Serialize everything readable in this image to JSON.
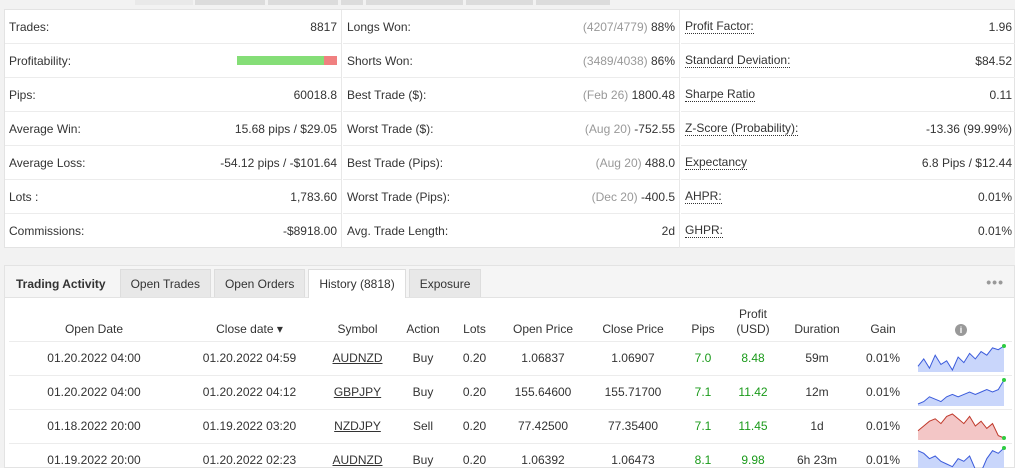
{
  "stats": {
    "col1": [
      {
        "label": "Trades:",
        "value": "8817"
      },
      {
        "label": "Profitability:",
        "bar": {
          "win_fraction": 0.865
        }
      },
      {
        "label": "Pips:",
        "value": "60018.8"
      },
      {
        "label": "Average Win:",
        "value": "15.68 pips / $29.05"
      },
      {
        "label": "Average Loss:",
        "value": "-54.12 pips / -$101.64"
      },
      {
        "label": "Lots :",
        "value": "1,783.60"
      },
      {
        "label": "Commissions:",
        "value": "-$8918.00"
      }
    ],
    "col2": [
      {
        "label": "Longs Won:",
        "muted": "(4207/4779)",
        "value": "88%"
      },
      {
        "label": "Shorts Won:",
        "muted": "(3489/4038)",
        "value": "86%"
      },
      {
        "label": "Best Trade ($):",
        "muted": "(Feb 26)",
        "value": "1800.48"
      },
      {
        "label": "Worst Trade ($):",
        "muted": "(Aug 20)",
        "value": "-752.55"
      },
      {
        "label": "Best Trade (Pips):",
        "muted": "(Aug 20)",
        "value": "488.0"
      },
      {
        "label": "Worst Trade (Pips):",
        "muted": "(Dec 20)",
        "value": "-400.5"
      },
      {
        "label": "Avg. Trade Length:",
        "muted": "",
        "value": "2d"
      }
    ],
    "col3": [
      {
        "label": "Profit Factor:",
        "value": "1.96"
      },
      {
        "label": "Standard Deviation:",
        "value": "$84.52"
      },
      {
        "label": "Sharpe Ratio",
        "value": "0.11"
      },
      {
        "label": "Z-Score (Probability):",
        "value": "-13.36 (99.99%)"
      },
      {
        "label": "Expectancy",
        "value": "6.8 Pips / $12.44"
      },
      {
        "label": "AHPR:",
        "value": "0.01%"
      },
      {
        "label": "GHPR:",
        "value": "0.01%"
      }
    ]
  },
  "activity": {
    "title": "Trading Activity",
    "tabs": [
      "Open Trades",
      "Open Orders",
      "History (8818)",
      "Exposure"
    ],
    "active_tab": 2,
    "more_glyph": "•••",
    "columns": {
      "open_date": "Open Date",
      "close_date": "Close date ▾",
      "symbol": "Symbol",
      "action": "Action",
      "lots": "Lots",
      "open_price": "Open Price",
      "close_price": "Close Price",
      "pips": "Pips",
      "profit_line1": "Profit",
      "profit_line2": "(USD)",
      "duration": "Duration",
      "gain": "Gain",
      "info_icon": "i"
    },
    "rows": [
      {
        "open_date": "01.20.2022 04:00",
        "close_date": "01.20.2022 04:59",
        "symbol": "AUDNZD",
        "action": "Buy",
        "lots": "0.20",
        "open_price": "1.06837",
        "close_price": "1.06907",
        "pips": "7.0",
        "profit": "8.48",
        "duration": "59m",
        "gain": "0.01%",
        "spark": {
          "color": "#3b5bdb",
          "fill": "#c9d6fb",
          "points": [
            5,
            9,
            4,
            11,
            6,
            8,
            3,
            10,
            7,
            12,
            9,
            13,
            11,
            15,
            14,
            16
          ]
        }
      },
      {
        "open_date": "01.20.2022 04:00",
        "close_date": "01.20.2022 04:12",
        "symbol": "GBPJPY",
        "action": "Buy",
        "lots": "0.20",
        "open_price": "155.64600",
        "close_price": "155.71700",
        "pips": "7.1",
        "profit": "11.42",
        "duration": "12m",
        "gain": "0.01%",
        "spark": {
          "color": "#3b5bdb",
          "fill": "#c9d6fb",
          "points": [
            3,
            4,
            6,
            5,
            4,
            6,
            7,
            6,
            7,
            8,
            7,
            8,
            9,
            8,
            9,
            13
          ]
        }
      },
      {
        "open_date": "01.18.2022 20:00",
        "close_date": "01.19.2022 03:20",
        "symbol": "NZDJPY",
        "action": "Sell",
        "lots": "0.20",
        "open_price": "77.42500",
        "close_price": "77.35400",
        "pips": "7.1",
        "profit": "11.45",
        "duration": "1d",
        "gain": "0.01%",
        "spark": {
          "color": "#c0392b",
          "fill": "#f3c6c6",
          "points": [
            6,
            8,
            10,
            11,
            9,
            12,
            13,
            11,
            9,
            12,
            8,
            10,
            7,
            9,
            4,
            3
          ]
        }
      },
      {
        "open_date": "01.19.2022 20:00",
        "close_date": "01.20.2022 02:23",
        "symbol": "AUDNZD",
        "action": "Buy",
        "lots": "0.20",
        "open_price": "1.06392",
        "close_price": "1.06473",
        "pips": "8.1",
        "profit": "9.98",
        "duration": "6h 23m",
        "gain": "0.01%",
        "spark": {
          "color": "#3b5bdb",
          "fill": "#c9d6fb",
          "points": [
            12,
            11,
            9,
            10,
            8,
            7,
            6,
            9,
            8,
            10,
            5,
            4,
            9,
            12,
            11,
            13
          ]
        }
      }
    ]
  },
  "colors": {
    "green": "#1a9a1a",
    "bar_green": "#85de77",
    "bar_red": "#f08080"
  }
}
